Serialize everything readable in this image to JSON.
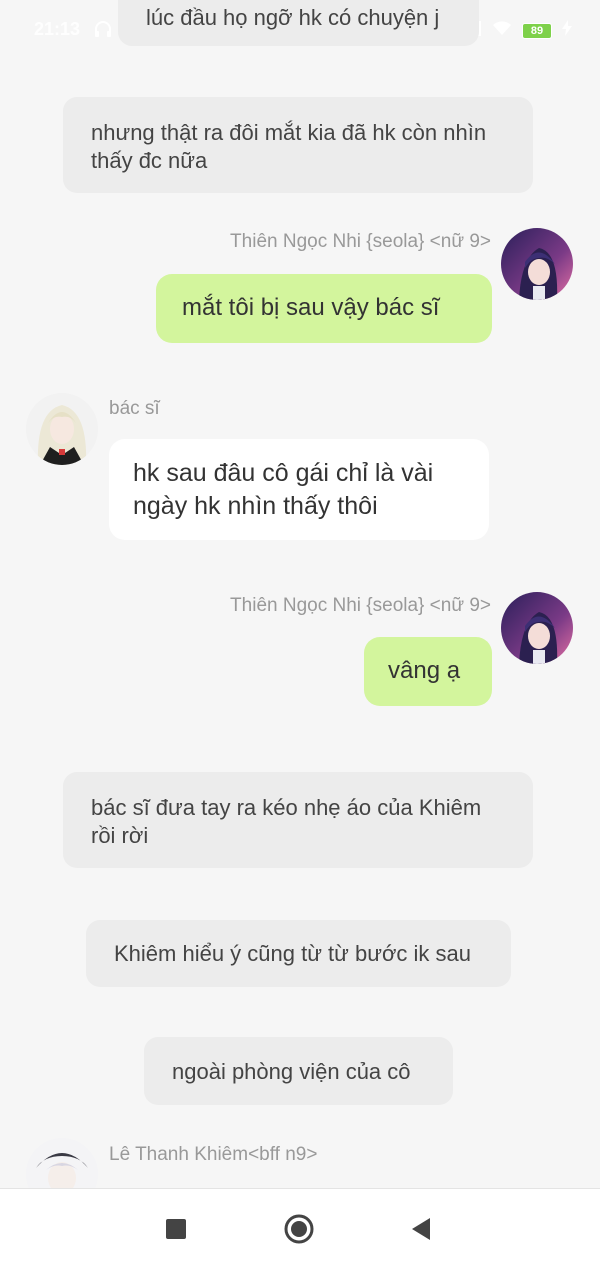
{
  "status_bar": {
    "time": "21:13",
    "headphone_icon": "headphones-icon",
    "battery": "89",
    "charging_icon": "bolt-icon"
  },
  "messages": {
    "narration_1": "lúc đầu họ ngỡ hk có chuyện j",
    "narration_2": "nhưng thật ra đôi mắt kia đã hk còn nhìn thấy đc nữa",
    "user_name_1": "Thiên Ngọc Nhi {seola} <nữ 9>",
    "user_msg_1": "mắt tôi bị sau vậy bác sĩ",
    "doctor_name": "bác sĩ",
    "doctor_msg": "hk sau đâu cô gái chỉ là vài ngày hk nhìn thấy thôi",
    "user_name_2": "Thiên Ngọc Nhi {seola} <nữ 9>",
    "user_msg_2": "vâng ạ",
    "narration_3": "bác sĩ đưa tay ra kéo nhẹ áo của Khiêm rồi rời",
    "narration_4": "Khiêm hiểu ý cũng từ từ bước ik sau",
    "narration_5": "ngoài phòng viện của cô",
    "friend_name": "Lê Thanh Khiêm<bff n9>"
  },
  "nav_bar": {
    "recents_icon": "square-icon",
    "home_icon": "circle-icon",
    "back_icon": "triangle-back-icon"
  },
  "colors": {
    "background": "#f6f6f6",
    "narration_bg": "#ececec",
    "user_bubble": "#d3f59d",
    "other_bubble": "#ffffff",
    "name_text": "#999999"
  }
}
